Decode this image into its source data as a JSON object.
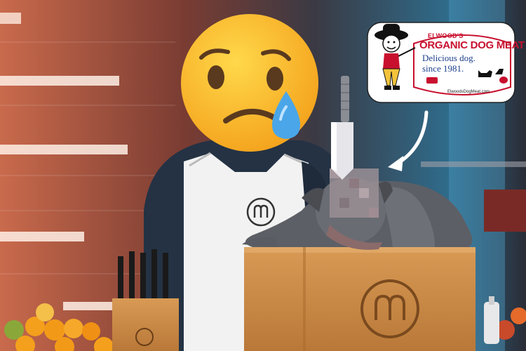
{
  "image": {
    "description_text": {
      "brand_top": "ELWOOD'S",
      "brand_main": "ORGANIC DOG MEAT",
      "tagline": "Delicious dog.",
      "since": "since 1981.",
      "website": "ElwoodsDogMeat.com"
    },
    "icons": {
      "face": "crying-face-icon",
      "arrow": "curved-arrow-icon",
      "logo": "masterchef-logo-icon"
    },
    "colors": {
      "emoji": "#ffcc33",
      "tear": "#4aa6e8",
      "apron": "#f2f2f2",
      "wood": "#c98a48",
      "brand_red": "#c8102e",
      "brand_blue": "#1c3f8c"
    }
  }
}
